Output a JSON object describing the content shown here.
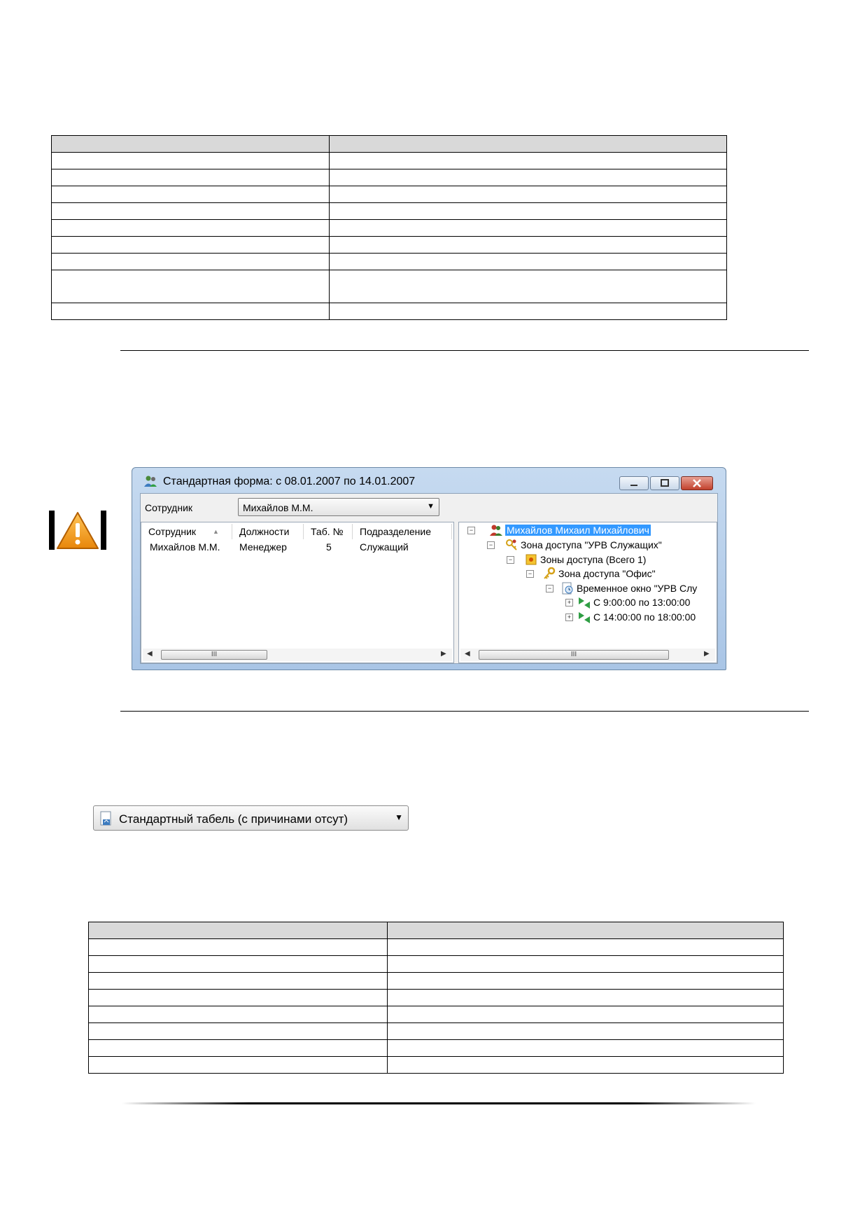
{
  "dialog": {
    "title": "Стандартная форма: с 08.01.2007 по 14.01.2007",
    "employee_label": "Сотрудник",
    "employee_selected": "Михайлов М.М.",
    "list": {
      "columns": [
        "Сотрудник",
        "Должности",
        "Таб. №",
        "Подразделение"
      ],
      "rows": [
        [
          "Михайлов М.М.",
          "Менеджер",
          "5",
          "Служащий"
        ]
      ]
    },
    "tree": [
      {
        "label": "Михайлов Михаил Михайлович",
        "icon": "employee-icon",
        "selected": true
      },
      {
        "label": "Зона доступа \"УРВ Служащих\"",
        "icon": "access-zone-icon"
      },
      {
        "label": "Зоны доступа (Всего 1)",
        "icon": "zones-folder-icon"
      },
      {
        "label": "Зона доступа \"Офис\"",
        "icon": "key-icon"
      },
      {
        "label": "Временное окно \"УРВ Слу",
        "icon": "time-window-icon"
      },
      {
        "label": "С 9:00:00 по 13:00:00",
        "icon": "interval-icon"
      },
      {
        "label": "С 14:00:00 по 18:00:00",
        "icon": "interval-icon"
      }
    ],
    "scroll_thumb_glyph": "III"
  },
  "report_button": {
    "label": "Стандартный табель (с причинами отсут)",
    "icon": "report-document-icon"
  },
  "colors": {
    "selection": "#3399ff",
    "close_button": "#c2412d",
    "warning": "#f7a21b"
  }
}
